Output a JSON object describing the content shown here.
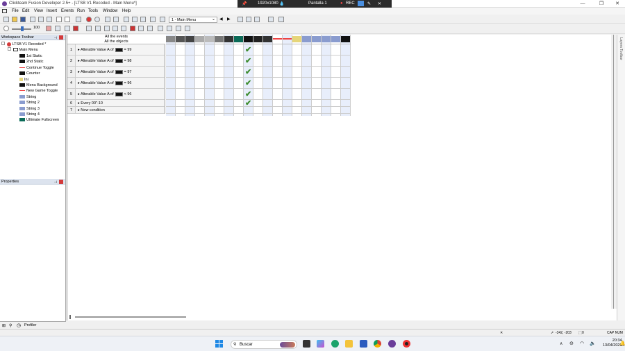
{
  "window": {
    "title": "Clickteam Fusion Developer 2.5+ - [LTSB V1 Recoded - Main Menu*]",
    "buttons": [
      "—",
      "❐",
      "✕"
    ]
  },
  "recorder": {
    "resolution": "1920x1080",
    "screen": "Pantalla 1",
    "rec": "REC"
  },
  "menu": [
    "File",
    "Edit",
    "View",
    "Insert",
    "Events",
    "Run",
    "Tools",
    "Window",
    "Help"
  ],
  "toolbar": {
    "frame_select": "1 - Main Menu",
    "zoom": "100"
  },
  "workspace": {
    "title": "Workspace Toolbar",
    "app": "LTSB V1 Recoded *",
    "frame": "Main Menu",
    "objects": [
      {
        "label": "1st Static",
        "icon": "black-rect"
      },
      {
        "label": "2nd Static",
        "icon": "black-rect"
      },
      {
        "label": "Continue Toggle",
        "icon": "red-line"
      },
      {
        "label": "Counter",
        "icon": "black-rect"
      },
      {
        "label": "Ini",
        "icon": "ini"
      },
      {
        "label": "Menu Background",
        "icon": "black-rect"
      },
      {
        "label": "New Game Toggle",
        "icon": "red-line"
      },
      {
        "label": "String",
        "icon": "string"
      },
      {
        "label": "String 2",
        "icon": "string"
      },
      {
        "label": "String 3",
        "icon": "string"
      },
      {
        "label": "String 4",
        "icon": "string"
      },
      {
        "label": "Ultimate Fullscreen",
        "icon": "teal"
      }
    ]
  },
  "properties": {
    "title": "Properties"
  },
  "bottom_tab": {
    "label": "Profiler"
  },
  "events": {
    "header_line1": "All the events",
    "header_line2": "All the objects",
    "rows": [
      {
        "num": "1",
        "text_before": "Alterable Value A of",
        "text_after": "= 99",
        "has_obj": true,
        "check": true
      },
      {
        "num": "2",
        "text_before": "Alterable Value A of",
        "text_after": "= 98",
        "has_obj": true,
        "check": true
      },
      {
        "num": "3",
        "text_before": "Alterable Value A of",
        "text_after": "= 97",
        "has_obj": true,
        "check": true
      },
      {
        "num": "4",
        "text_before": "Alterable Value A of",
        "text_after": "= 96",
        "has_obj": true,
        "check": true
      },
      {
        "num": "5",
        "text_before": "Alterable Value A of",
        "text_after": "< 96",
        "has_obj": true,
        "check": true
      },
      {
        "num": "6",
        "text_before": "Every 00\"-10",
        "text_after": "",
        "has_obj": false,
        "check": true
      },
      {
        "num": "7",
        "text_before": "New condition",
        "text_after": "",
        "has_obj": false,
        "check": false
      }
    ]
  },
  "layers_toolbar": "Layers Toolbar",
  "status": {
    "coords": "-342, -203",
    "zero": "0",
    "caps": "CAP NUM"
  },
  "taskbar": {
    "search": "Buscar",
    "time": "20:34",
    "date": "13/04/2026"
  }
}
